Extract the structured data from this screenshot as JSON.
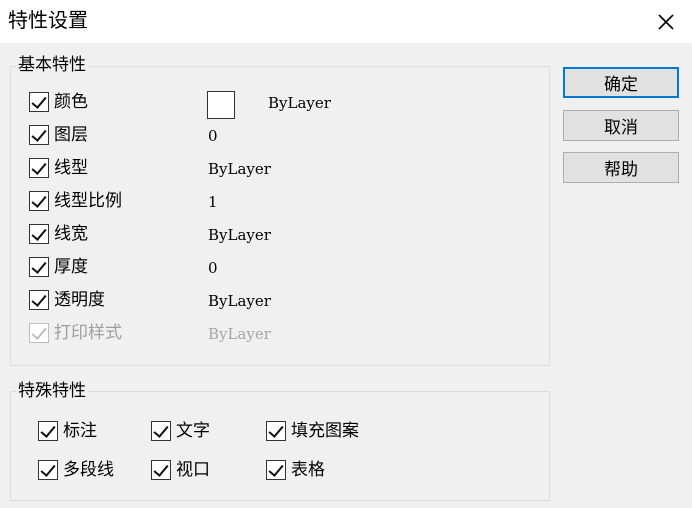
{
  "window": {
    "title": "特性设置"
  },
  "basic": {
    "legend": "基本特性",
    "items": [
      {
        "label": "颜色",
        "value": "ByLayer",
        "enabled": true
      },
      {
        "label": "图层",
        "value": "0",
        "enabled": true
      },
      {
        "label": "线型",
        "value": "ByLayer",
        "enabled": true
      },
      {
        "label": "线型比例",
        "value": "1",
        "enabled": true
      },
      {
        "label": "线宽",
        "value": "ByLayer",
        "enabled": true
      },
      {
        "label": "厚度",
        "value": "0",
        "enabled": true
      },
      {
        "label": "透明度",
        "value": "ByLayer",
        "enabled": true
      },
      {
        "label": "打印样式",
        "value": "ByLayer",
        "enabled": false
      }
    ],
    "color_swatch": "#ffffff"
  },
  "special": {
    "legend": "特殊特性",
    "items": [
      {
        "label": "标注",
        "checked": true
      },
      {
        "label": "文字",
        "checked": true
      },
      {
        "label": "填充图案",
        "checked": true
      },
      {
        "label": "多段线",
        "checked": true
      },
      {
        "label": "视口",
        "checked": true
      },
      {
        "label": "表格",
        "checked": true
      }
    ]
  },
  "buttons": {
    "ok": "确定",
    "cancel": "取消",
    "help": "帮助"
  },
  "colors": {
    "accent": "#0078d7",
    "disabled_text": "#9e9e9e",
    "window_bg": "#f0f0f0",
    "title_bg": "#ffffff"
  },
  "icons": {
    "close": "close-icon",
    "check": "check-icon"
  }
}
